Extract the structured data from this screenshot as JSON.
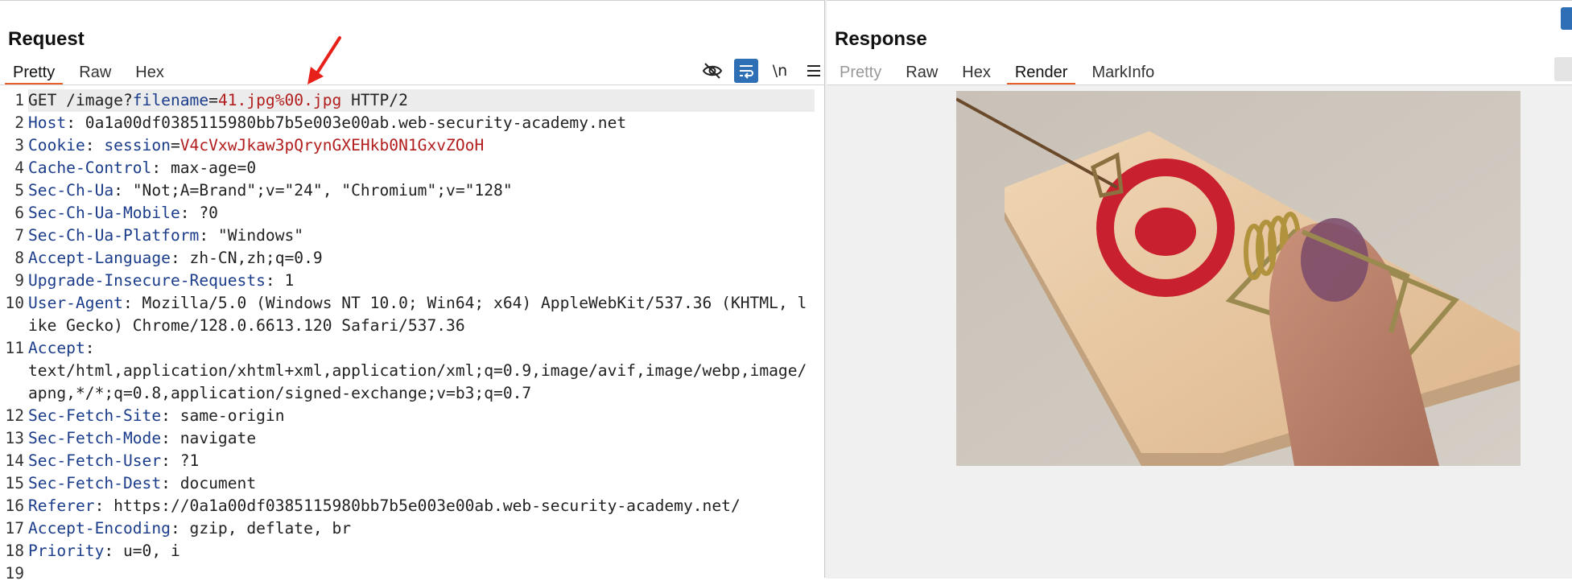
{
  "request": {
    "title": "Request",
    "tabs": [
      {
        "label": "Pretty",
        "active": true
      },
      {
        "label": "Raw",
        "active": false
      },
      {
        "label": "Hex",
        "active": false
      }
    ],
    "toolbar": {
      "hide_icon": "eye-slash-icon",
      "wrap_icon": "text-wrap-icon",
      "newline_label": "\\n",
      "menu_icon": "hamburger-menu-icon"
    },
    "lines": [
      {
        "n": "1",
        "parts": [
          [
            "t",
            "GET /image?"
          ],
          [
            "h",
            "filename"
          ],
          [
            "t",
            "="
          ],
          [
            "r",
            "41.jpg%00.jpg"
          ],
          [
            "t",
            " HTTP/2"
          ]
        ],
        "highlight": true
      },
      {
        "n": "2",
        "parts": [
          [
            "h",
            "Host"
          ],
          [
            "t",
            ": 0a1a00df0385115980bb7b5e003e00ab.web-security-academy.net"
          ]
        ]
      },
      {
        "n": "3",
        "parts": [
          [
            "h",
            "Cookie"
          ],
          [
            "t",
            ": "
          ],
          [
            "h",
            "session"
          ],
          [
            "t",
            "="
          ],
          [
            "r",
            "V4cVxwJkaw3pQrynGXEHkb0N1GxvZOoH"
          ]
        ]
      },
      {
        "n": "4",
        "parts": [
          [
            "h",
            "Cache-Control"
          ],
          [
            "t",
            ": max-age=0"
          ]
        ]
      },
      {
        "n": "5",
        "parts": [
          [
            "h",
            "Sec-Ch-Ua"
          ],
          [
            "t",
            ": \"Not;A=Brand\";v=\"24\", \"Chromium\";v=\"128\""
          ]
        ]
      },
      {
        "n": "6",
        "parts": [
          [
            "h",
            "Sec-Ch-Ua-Mobile"
          ],
          [
            "t",
            ": ?0"
          ]
        ]
      },
      {
        "n": "7",
        "parts": [
          [
            "h",
            "Sec-Ch-Ua-Platform"
          ],
          [
            "t",
            ": \"Windows\""
          ]
        ]
      },
      {
        "n": "8",
        "parts": [
          [
            "h",
            "Accept-Language"
          ],
          [
            "t",
            ": zh-CN,zh;q=0.9"
          ]
        ]
      },
      {
        "n": "9",
        "parts": [
          [
            "h",
            "Upgrade-Insecure-Requests"
          ],
          [
            "t",
            ": 1"
          ]
        ]
      },
      {
        "n": "10",
        "parts": [
          [
            "h",
            "User-Agent"
          ],
          [
            "t",
            ": Mozilla/5.0 (Windows NT 10.0; Win64; x64) AppleWebKit/537.36 (KHTML, like Gecko) Chrome/128.0.6613.120 Safari/537.36"
          ]
        ]
      },
      {
        "n": "11",
        "parts": [
          [
            "h",
            "Accept"
          ],
          [
            "t",
            ":\ntext/html,application/xhtml+xml,application/xml;q=0.9,image/avif,image/webp,image/apng,*/*;q=0.8,application/signed-exchange;v=b3;q=0.7"
          ]
        ]
      },
      {
        "n": "12",
        "parts": [
          [
            "h",
            "Sec-Fetch-Site"
          ],
          [
            "t",
            ": same-origin"
          ]
        ]
      },
      {
        "n": "13",
        "parts": [
          [
            "h",
            "Sec-Fetch-Mode"
          ],
          [
            "t",
            ": navigate"
          ]
        ]
      },
      {
        "n": "14",
        "parts": [
          [
            "h",
            "Sec-Fetch-User"
          ],
          [
            "t",
            ": ?1"
          ]
        ]
      },
      {
        "n": "15",
        "parts": [
          [
            "h",
            "Sec-Fetch-Dest"
          ],
          [
            "t",
            ": document"
          ]
        ]
      },
      {
        "n": "16",
        "parts": [
          [
            "h",
            "Referer"
          ],
          [
            "t",
            ": https://0a1a00df0385115980bb7b5e003e00ab.web-security-academy.net/"
          ]
        ]
      },
      {
        "n": "17",
        "parts": [
          [
            "h",
            "Accept-Encoding"
          ],
          [
            "t",
            ": gzip, deflate, br"
          ]
        ]
      },
      {
        "n": "18",
        "parts": [
          [
            "h",
            "Priority"
          ],
          [
            "t",
            ": u=0, i"
          ]
        ]
      },
      {
        "n": "19",
        "parts": [
          [
            "t",
            ""
          ]
        ]
      }
    ]
  },
  "response": {
    "title": "Response",
    "tabs": [
      {
        "label": "Pretty",
        "active": false,
        "disabled": true
      },
      {
        "label": "Raw",
        "active": false
      },
      {
        "label": "Hex",
        "active": false
      },
      {
        "label": "Render",
        "active": true
      },
      {
        "label": "MarkInfo",
        "active": false
      }
    ],
    "rendered_image": "mousetrap-photo"
  },
  "colors": {
    "header_name": "#1a3c8a",
    "param_value": "#b21e1e",
    "active_tab_underline": "#e8602c",
    "toggle_on": "#2f6fb5",
    "annotation_arrow": "#e8201a"
  }
}
